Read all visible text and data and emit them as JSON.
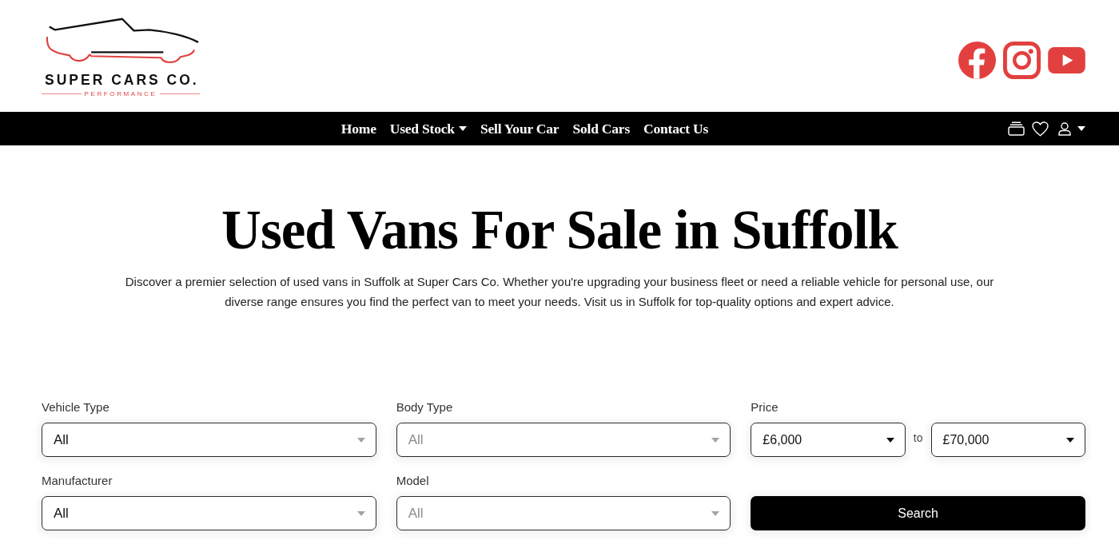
{
  "header": {
    "logo": {
      "name": "SUPER CARS CO.",
      "tagline": "PERFORMANCE"
    },
    "social_links": [
      {
        "kind": "facebook"
      },
      {
        "kind": "instagram"
      },
      {
        "kind": "youtube"
      }
    ]
  },
  "nav": {
    "items": [
      {
        "label": "Home",
        "dropdown": false
      },
      {
        "label": "Used Stock",
        "dropdown": true
      },
      {
        "label": "Sell Your Car",
        "dropdown": false
      },
      {
        "label": "Sold Cars",
        "dropdown": false
      },
      {
        "label": "Contact Us",
        "dropdown": false
      }
    ]
  },
  "hero": {
    "title": "Used Vans For Sale in Suffolk",
    "intro": "Discover a premier selection of used vans in Suffolk at Super Cars Co. Whether you're upgrading your business fleet or need a reliable vehicle for personal use, our diverse range ensures you find the perfect van to meet your needs. Visit us in Suffolk for top-quality options and expert advice."
  },
  "filters": [
    {
      "kind": "select",
      "label": "Vehicle Type",
      "value": "All",
      "disabled": false
    },
    {
      "kind": "select",
      "label": "Body Type",
      "value": "All",
      "disabled": true
    },
    {
      "kind": "range",
      "label": "Price",
      "min": "£6,000",
      "separator": "to",
      "max": "£70,000"
    },
    {
      "kind": "select",
      "label": "Manufacturer",
      "value": "All",
      "disabled": false
    },
    {
      "kind": "select",
      "label": "Model",
      "value": "All",
      "disabled": true
    },
    {
      "kind": "button",
      "label": "Search"
    }
  ]
}
